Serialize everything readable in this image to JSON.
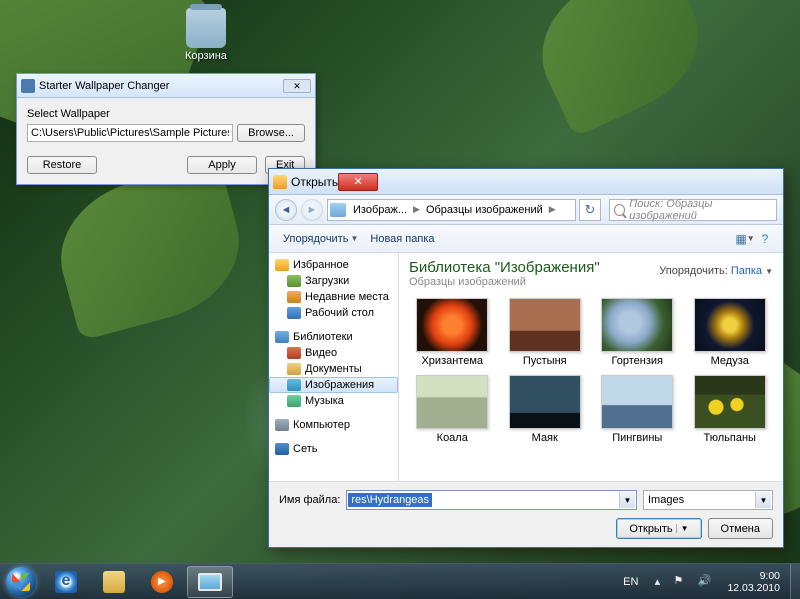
{
  "desktop": {
    "recycle_bin": "Корзина"
  },
  "changer": {
    "title": "Starter Wallpaper Changer",
    "select_label": "Select Wallpaper",
    "path": "C:\\Users\\Public\\Pictures\\Sample Pictures\\Hydrangeas.jp",
    "browse": "Browse...",
    "restore": "Restore",
    "apply": "Apply",
    "exit": "Exit"
  },
  "dialog": {
    "title": "Открыть",
    "breadcrumb": {
      "seg1": "Изображ...",
      "seg2": "Образцы изображений"
    },
    "search_placeholder": "Поиск: Образцы изображений",
    "organize": "Упорядочить",
    "new_folder": "Новая папка",
    "lib_title": "Библиотека \"Изображения\"",
    "lib_sub": "Образцы изображений",
    "sort_label": "Упорядочить:",
    "sort_value": "Папка",
    "tree": {
      "favorites": "Избранное",
      "downloads": "Загрузки",
      "recent": "Недавние места",
      "desktop": "Рабочий стол",
      "libraries": "Библиотеки",
      "video": "Видео",
      "documents": "Документы",
      "images": "Изображения",
      "music": "Музыка",
      "computer": "Компьютер",
      "network": "Сеть"
    },
    "thumbs": [
      "Хризантема",
      "Пустыня",
      "Гортензия",
      "Медуза",
      "Коала",
      "Маяк",
      "Пингвины",
      "Тюльпаны"
    ],
    "file_label": "Имя файла:",
    "file_value": "res\\Hydrangeas",
    "filter": "Images",
    "open": "Открыть",
    "cancel": "Отмена"
  },
  "taskbar": {
    "lang": "EN",
    "time": "9:00",
    "date": "12.03.2010"
  }
}
